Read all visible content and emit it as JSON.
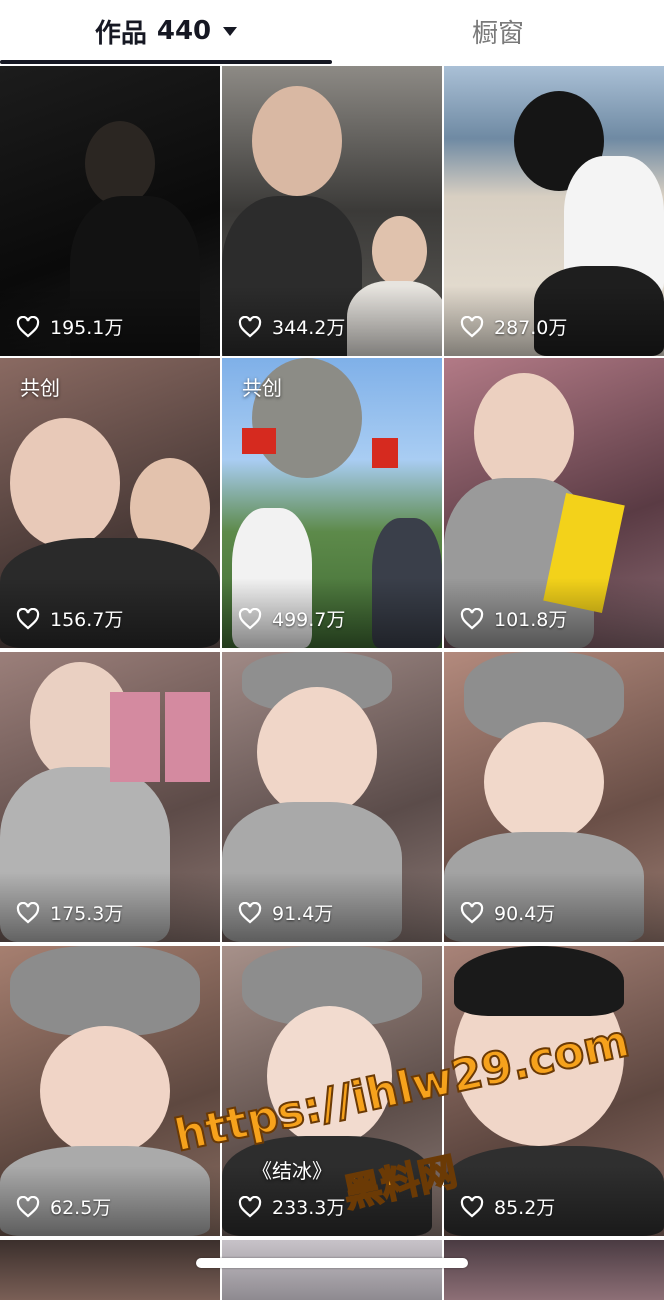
{
  "tabs": {
    "works_label": "作品",
    "works_count": "440",
    "showcase_label": "橱窗"
  },
  "grid": [
    {
      "likes": "195.1万",
      "badge": "",
      "caption": ""
    },
    {
      "likes": "344.2万",
      "badge": "",
      "caption": ""
    },
    {
      "likes": "287.0万",
      "badge": "",
      "caption": ""
    },
    {
      "likes": "156.7万",
      "badge": "共创",
      "caption": ""
    },
    {
      "likes": "499.7万",
      "badge": "共创",
      "caption": ""
    },
    {
      "likes": "101.8万",
      "badge": "",
      "caption": ""
    },
    {
      "likes": "175.3万",
      "badge": "",
      "caption": ""
    },
    {
      "likes": "91.4万",
      "badge": "",
      "caption": ""
    },
    {
      "likes": "90.4万",
      "badge": "",
      "caption": ""
    },
    {
      "likes": "62.5万",
      "badge": "",
      "caption": ""
    },
    {
      "likes": "233.3万",
      "badge": "",
      "caption": "《结冰》"
    },
    {
      "likes": "85.2万",
      "badge": "",
      "caption": ""
    }
  ],
  "watermark": {
    "url": "https://ihlw29.com",
    "site_name": "黑料网"
  },
  "colors": {
    "accent_text": "#161823",
    "inactive_text": "#7a7a7a",
    "watermark": "#f6a21c"
  }
}
